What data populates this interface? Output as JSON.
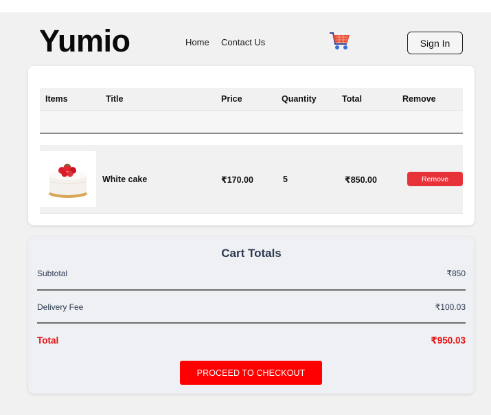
{
  "header": {
    "logo": "Yumio",
    "nav": [
      "Home",
      "Contact Us"
    ],
    "cart_icon": "shopping-cart-icon",
    "sign_in_label": "Sign In"
  },
  "cart_table": {
    "headers": [
      "Items",
      "Title",
      "Price",
      "Quantity",
      "Total",
      "Remove"
    ],
    "rows": [
      {
        "image": "white-cake-image",
        "title": "White cake",
        "price": "₹170.00",
        "quantity": "5",
        "total": "₹850.00",
        "remove_label": "Remove"
      }
    ]
  },
  "cart_totals": {
    "title": "Cart Totals",
    "subtotal_label": "Subtotal",
    "subtotal_value": "₹850",
    "delivery_label": "Delivery Fee",
    "delivery_value": "₹100.03",
    "total_label": "Total",
    "total_value": "₹950.03",
    "checkout_label": "PROCEED TO CHECKOUT"
  },
  "colors": {
    "accent_red": "#ff0000",
    "remove_red": "#e8323a",
    "total_red": "#e61010",
    "heading": "#2d3a4f"
  }
}
